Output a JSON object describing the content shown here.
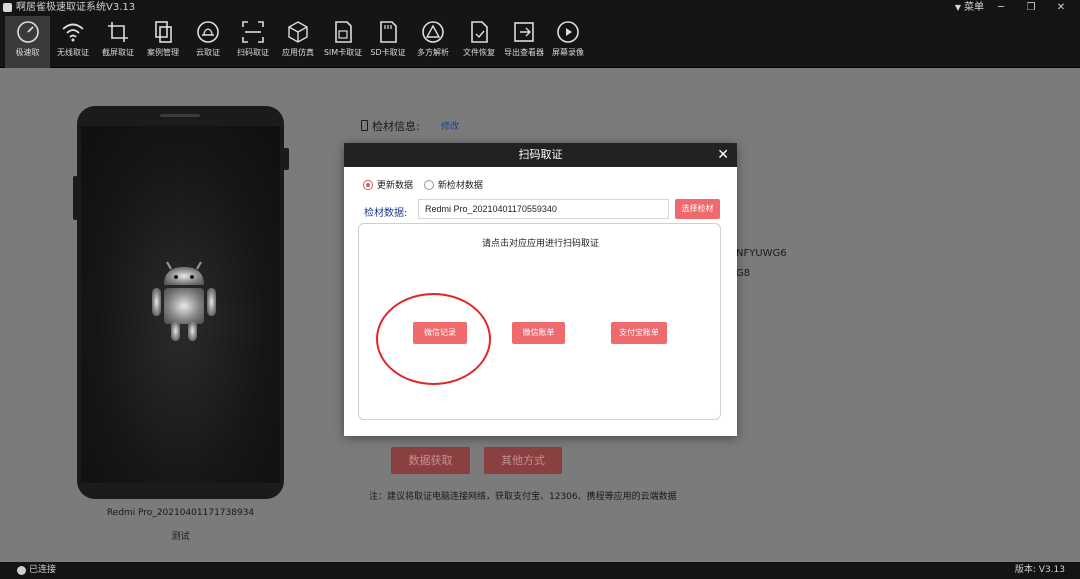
{
  "window": {
    "title": "啊居雀极速取证系统V3.13",
    "menu_label": "菜单",
    "min": "─",
    "max": "❐",
    "close": "✕"
  },
  "toolbar": {
    "items": [
      {
        "label": "极速取",
        "icon": "speed-icon"
      },
      {
        "label": "无线取证",
        "icon": "wifi-icon"
      },
      {
        "label": "截屏取证",
        "icon": "crop-icon"
      },
      {
        "label": "案例管理",
        "icon": "copy-icon"
      },
      {
        "label": "云取证",
        "icon": "cloud-icon"
      },
      {
        "label": "扫码取证",
        "icon": "scan-icon"
      },
      {
        "label": "应用仿真",
        "icon": "cube-icon"
      },
      {
        "label": "SIM卡取证",
        "icon": "sim-icon"
      },
      {
        "label": "SD卡取证",
        "icon": "sd-icon"
      },
      {
        "label": "多方解析",
        "icon": "triangle-icon"
      },
      {
        "label": "文件恢复",
        "icon": "file-icon"
      },
      {
        "label": "导出查看器",
        "icon": "export-icon"
      },
      {
        "label": "屏幕录像",
        "icon": "play-icon"
      }
    ]
  },
  "device": {
    "name": "Redmi Pro_20210401171738934",
    "desc": "测试"
  },
  "info": {
    "label": "检材信息:",
    "link": "修改",
    "code1": "NFYUWG6",
    "code2": "G8",
    "btn_fetch": "数据获取",
    "btn_other": "其他方式",
    "note": "注：建议将取证电脑连接网络，获取支付宝、12306、携程等应用的云端数据"
  },
  "dialog": {
    "title": "扫码取证",
    "close": "✕",
    "radio_update": "更新数据",
    "radio_new": "新检材数据",
    "field_label": "检材数据:",
    "field_value": "Redmi Pro_20210401170559340",
    "select_btn": "选择检材",
    "panel_title": "请点击对应应用进行扫码取证",
    "btn_wechat_record": "微信记录",
    "btn_wechat_bill": "微信账单",
    "btn_alipay_bill": "支付宝账单"
  },
  "status": {
    "connection": "已连接",
    "version": "版本: V3.13"
  },
  "colors": {
    "accent": "#ef6a6c",
    "annotation": "#e0262b",
    "toolbar_bg": "#151515"
  }
}
